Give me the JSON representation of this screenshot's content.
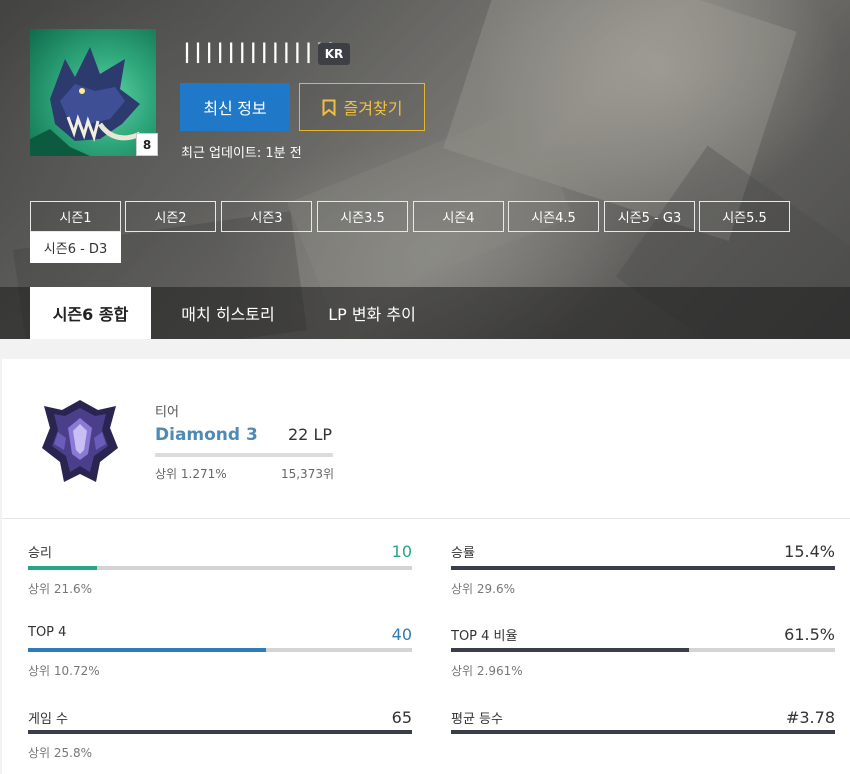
{
  "profile": {
    "summoner_name": "||||||||||||||",
    "region": "KR",
    "level": "8",
    "refresh_label": "최신 정보",
    "favorite_label": "즐겨찾기",
    "updated_text": "최근 업데이트: 1분 전",
    "avatar_icon": "werewolf-champion-icon"
  },
  "seasons": [
    "시즌1",
    "시즌2",
    "시즌3",
    "시즌3.5",
    "시즌4",
    "시즌4.5",
    "시즌5 - G3",
    "시즌5.5",
    "시즌6 - D3"
  ],
  "active_season": "시즌6 - D3",
  "nav_tabs": [
    "시즌6 종합",
    "매치 히스토리",
    "LP 변화 추이"
  ],
  "active_nav": "시즌6 종합",
  "tier": {
    "title": "티어",
    "name": "Diamond 3",
    "lp": "22 LP",
    "rank_pct": "상위 1.271%",
    "rank_pos": "15,373위",
    "emblem_icon": "diamond-tier-emblem-icon"
  },
  "stats": {
    "wins": {
      "label": "승리",
      "value": "10",
      "rank": "상위 21.6%",
      "fill": 0.18,
      "color": "#26a58a"
    },
    "winrate": {
      "label": "승률",
      "value": "15.4%",
      "rank": "상위 29.6%",
      "fill": 1.0,
      "color": "#3a3d4a"
    },
    "top4": {
      "label": "TOP 4",
      "value": "40",
      "rank": "상위 10.72%",
      "fill": 0.62,
      "color": "#2f7ab8"
    },
    "top4rate": {
      "label": "TOP 4 비율",
      "value": "61.5%",
      "rank": "상위 2.961%",
      "fill": 0.62,
      "color": "#3a3d4a"
    },
    "games": {
      "label": "게임 수",
      "value": "65",
      "rank": "상위 25.8%",
      "fill": 1.0,
      "color": "#3a3d4a"
    },
    "avgplace": {
      "label": "평균 등수",
      "value": "#3.78",
      "rank": "",
      "fill": 1.0,
      "color": "#3a3d4a"
    }
  },
  "colors": {
    "accent_blue": "#1f78c8",
    "favorite_gold": "#e7b62e",
    "tier_blue": "#4e8ab3"
  }
}
